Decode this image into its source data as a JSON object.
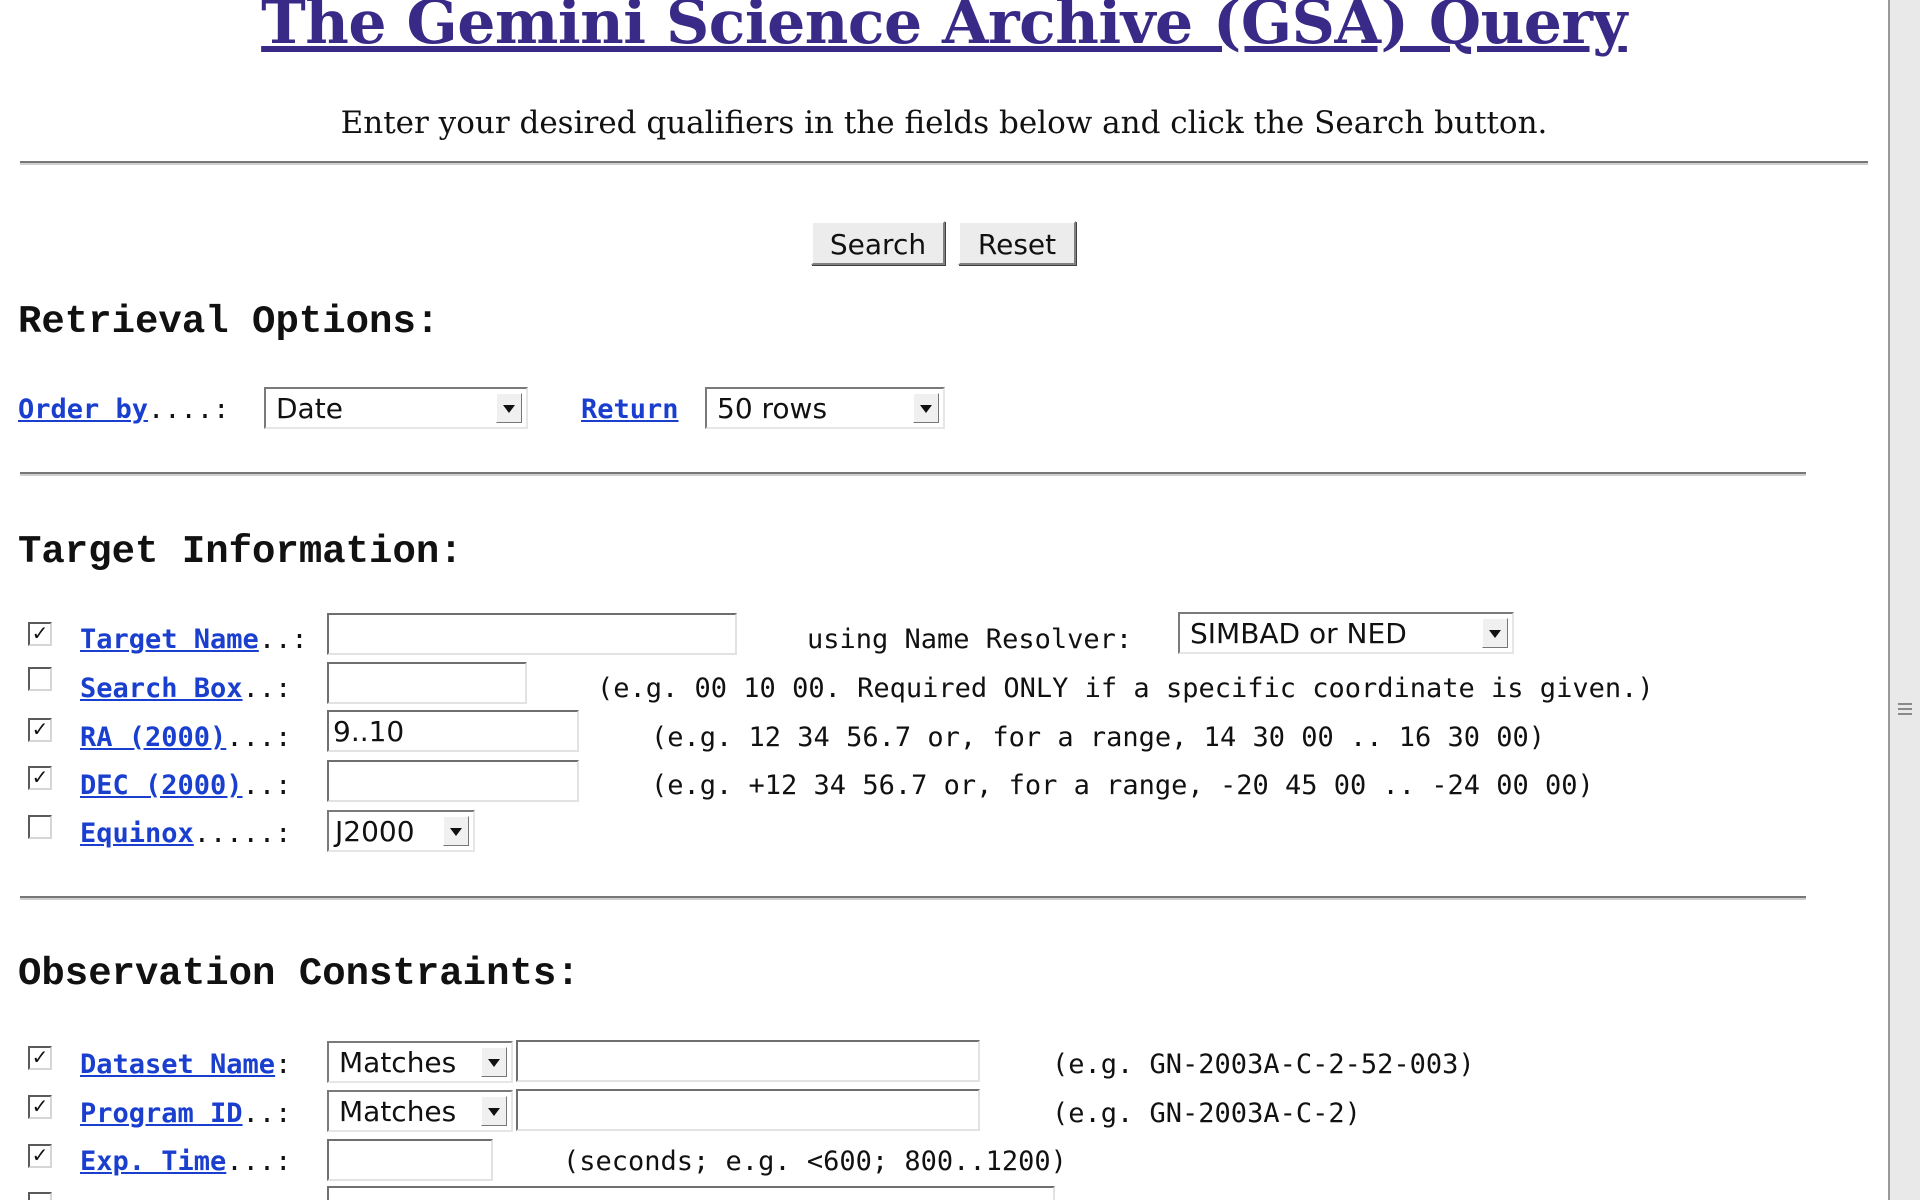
{
  "page": {
    "title": "The Gemini Science Archive (GSA) Query",
    "subtitle": "Enter your desired qualifiers in the fields below and click the Search button."
  },
  "buttons": {
    "search": "Search",
    "reset": "Reset"
  },
  "retrieval": {
    "heading": "Retrieval Options:",
    "order_by_label": "Order by",
    "order_by_dots": "....:",
    "order_by_value": "Date",
    "return_label": "Return",
    "return_value": "50 rows"
  },
  "target": {
    "heading": "Target Information:",
    "rows": [
      {
        "checked": "✓",
        "label": "Target Name",
        "dots": "..:",
        "value": "",
        "extra_label": "using Name Resolver:",
        "resolver": "SIMBAD or NED"
      },
      {
        "checked": "",
        "label": "Search Box",
        "dots": "..:",
        "value": "",
        "hint": "(e.g. 00 10 00.  Required ONLY if a specific coordinate is given.)"
      },
      {
        "checked": "✓",
        "label": "RA (2000)",
        "dots": "...:",
        "value": "9..10",
        "hint": "(e.g. 12 34 56.7 or, for a range, 14 30 00 .. 16 30 00)"
      },
      {
        "checked": "✓",
        "label": "DEC (2000)",
        "dots": "..:",
        "value": "",
        "hint": "(e.g. +12 34 56.7 or, for a range, -20 45 00 .. -24 00 00)"
      },
      {
        "checked": "",
        "label": "Equinox",
        "dots": ".....:",
        "select": "J2000"
      }
    ]
  },
  "observation": {
    "heading": "Observation Constraints:",
    "rows": [
      {
        "checked": "✓",
        "label": "Dataset Name",
        "dots": ":",
        "select": "Matches",
        "value": "",
        "hint": "(e.g. GN-2003A-C-2-52-003)"
      },
      {
        "checked": "✓",
        "label": "Program ID",
        "dots": "..:",
        "select": "Matches",
        "value": "",
        "hint": "(e.g. GN-2003A-C-2)"
      },
      {
        "checked": "✓",
        "label": "Exp. Time",
        "dots": "...:",
        "value": "",
        "hint": "(seconds; e.g. <600; 800..1200)"
      }
    ]
  },
  "icons": {
    "dropdown": "chevron-down-icon",
    "checkbox": "checkbox-icon",
    "grip": "scroll-grip-icon"
  }
}
